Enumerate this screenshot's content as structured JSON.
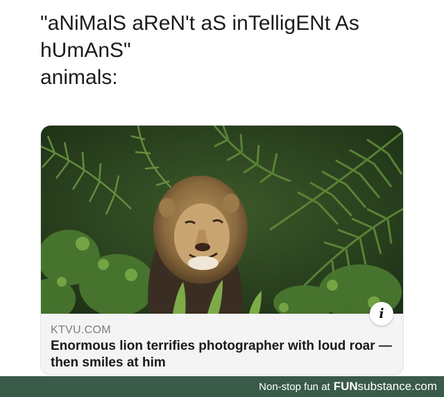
{
  "post": {
    "line1": "\"aNiMalS aReN't aS inTelligENt As",
    "line2": "hUmAnS\"",
    "line3": "animals:"
  },
  "card": {
    "source": "KTVU.COM",
    "headline": "Enormous lion terrifies photographer with loud roar — then smiles at him",
    "info_glyph": "i"
  },
  "footer": {
    "tagline": "Non-stop fun at",
    "brand_bold": "FUN",
    "brand_rest": "substance.com"
  },
  "colors": {
    "footer_bg": "#3a5a4a",
    "card_bg": "#f4f4f5",
    "source_text": "#7c7c80"
  }
}
